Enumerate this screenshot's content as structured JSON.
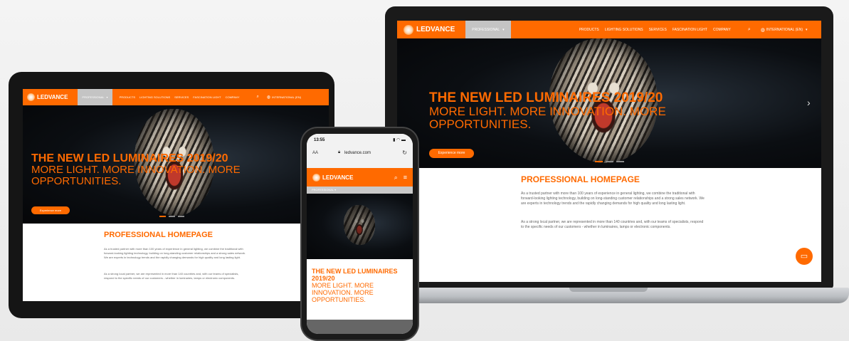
{
  "brand": {
    "accent": "#ff6a00",
    "logo_text": "LEDVANCE"
  },
  "nav": {
    "professional": "PROFESSIONAL",
    "items": [
      "PRODUCTS",
      "LIGHTING SOLUTIONS",
      "SERVICES",
      "FASCINATION LIGHT",
      "COMPANY"
    ],
    "region": "INTERNATIONAL (EN)",
    "search_icon": "search-icon",
    "globe_icon": "globe-icon",
    "menu_icon": "hamburger-icon"
  },
  "hero": {
    "title": "THE NEW LED LUMINAIRES 2019/20",
    "subtitle": "MORE LIGHT. MORE INNOVATION. MORE OPPORTUNITIES.",
    "cta": "Experience more",
    "next_icon": "chevron-right-icon"
  },
  "content": {
    "heading": "PROFESSIONAL HOMEPAGE",
    "p1": "As a trusted partner with more than 100 years of experience in general lighting, we combine the traditional with forward-looking lighting technology, building on long-standing customer relationships and a strong sales network. We are experts in technology trends and the rapidly changing demands for high quality and long lasting light.",
    "p2": "As a strong local partner, we are represented in more than 140 countries and, with our teams of specialists, respond to the specific needs of our customers - whether in luminaires, lamps or electronic components."
  },
  "phone": {
    "time": "13:55",
    "url": "ledvance.com",
    "text_size": "AA",
    "professional": "PROFESSIONAL",
    "title": "THE NEW LED LUMINAIRES 2019/20",
    "subtitle": "MORE LIGHT. MORE INNOVATION. MORE OPPORTUNITIES."
  },
  "chat_icon": "chat-icon"
}
